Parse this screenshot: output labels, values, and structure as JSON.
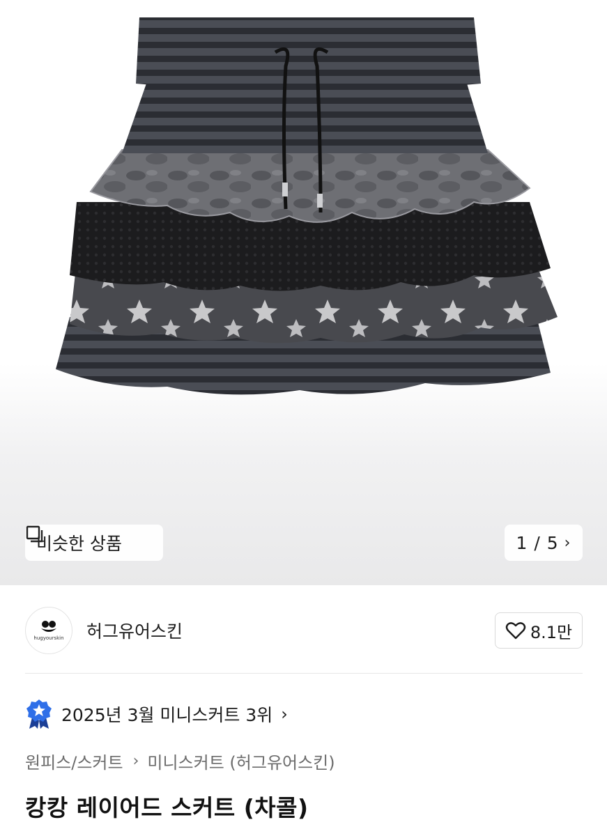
{
  "image_viewer": {
    "similar_label": "비슷한 상품",
    "counter": "1 / 5",
    "image_subject": "layered skirt product photo"
  },
  "seller": {
    "logo_text": "hugyourskin",
    "name": "허그유어스킨",
    "like_count": "8.1만"
  },
  "ranking": {
    "text": "2025년 3월 미니스커트 3위"
  },
  "breadcrumb": {
    "category": "원피스/스커트",
    "subcategory": "미니스커트 (허그유어스킨)"
  },
  "product": {
    "title": "캉캉 레이어드 스커트 (차콜)"
  },
  "colors": {
    "accent_blue": "#2f6fe8",
    "text_primary": "#111111",
    "text_secondary": "#6b6b6b"
  }
}
